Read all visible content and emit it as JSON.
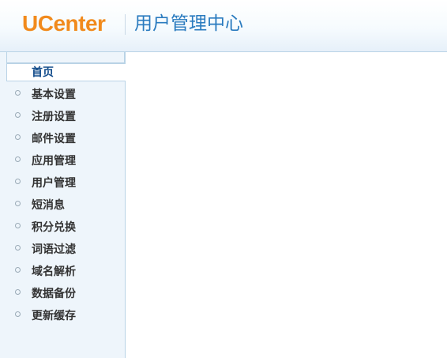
{
  "header": {
    "logo_text": "UCenter",
    "app_title": "用户管理中心"
  },
  "nav": {
    "active_label": "首页",
    "items": [
      {
        "label": "基本设置"
      },
      {
        "label": "注册设置"
      },
      {
        "label": "邮件设置"
      },
      {
        "label": "应用管理"
      },
      {
        "label": "用户管理"
      },
      {
        "label": "短消息"
      },
      {
        "label": "积分兑换"
      },
      {
        "label": "词语过滤"
      },
      {
        "label": "域名解析"
      },
      {
        "label": "数据备份"
      },
      {
        "label": "更新缓存"
      }
    ]
  },
  "colors": {
    "logo": "#f18a1c",
    "title": "#2a7bbf",
    "sidebar_bg": "#eef5fb",
    "active_text": "#114b8a"
  }
}
